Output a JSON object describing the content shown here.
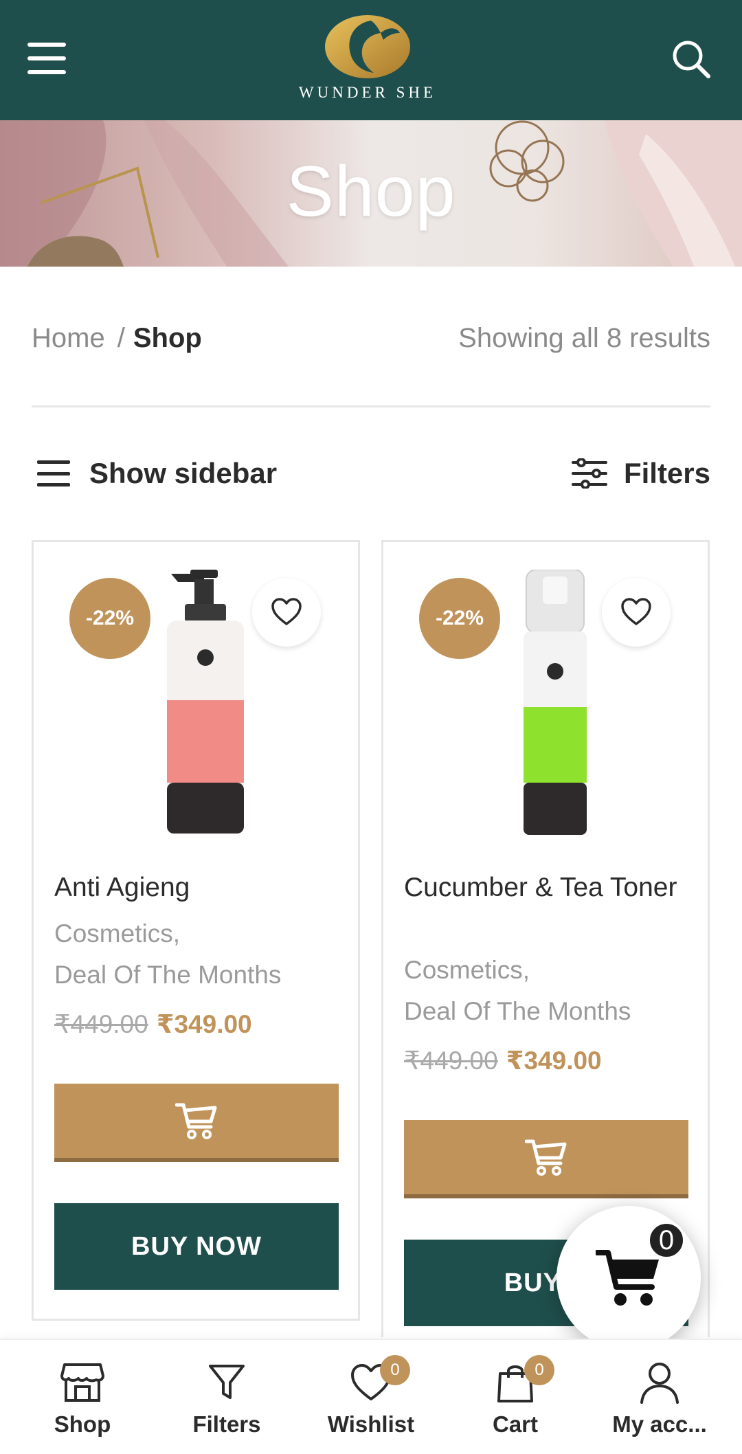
{
  "header": {
    "logo_text": "WUNDER SHE",
    "menu_icon": "hamburger-menu-icon",
    "search_icon": "search-icon"
  },
  "hero": {
    "title": "Shop"
  },
  "breadcrumb": {
    "home": "Home",
    "separator": "/",
    "current": "Shop"
  },
  "results_text": "Showing all 8 results",
  "toolbar": {
    "show_sidebar": "Show sidebar",
    "filters": "Filters"
  },
  "products": [
    {
      "badge": "-22%",
      "title": "Anti Agieng",
      "categories": [
        "Cosmetics,",
        "Deal Of The Months"
      ],
      "old_price": "₹449.00",
      "new_price": "₹349.00",
      "buy_label": "BUY NOW",
      "label_color": "#f08b86"
    },
    {
      "badge": "-22%",
      "title": "Cucumber & Tea Toner",
      "categories": [
        "Cosmetics,",
        "Deal Of The Months"
      ],
      "old_price": "₹449.00",
      "new_price": "₹349.00",
      "buy_label": "BUY N",
      "label_color": "#8ee22e"
    }
  ],
  "floating_cart": {
    "count": "0"
  },
  "bottom_nav": [
    {
      "label": "Shop",
      "icon": "store-icon"
    },
    {
      "label": "Filters",
      "icon": "filter-icon"
    },
    {
      "label": "Wishlist",
      "icon": "heart-icon",
      "count": "0"
    },
    {
      "label": "Cart",
      "icon": "shopping-bag-icon",
      "count": "0"
    },
    {
      "label": "My acc...",
      "icon": "user-icon"
    }
  ],
  "colors": {
    "brand_dark": "#1f4f4c",
    "accent_gold": "#c0935a"
  }
}
